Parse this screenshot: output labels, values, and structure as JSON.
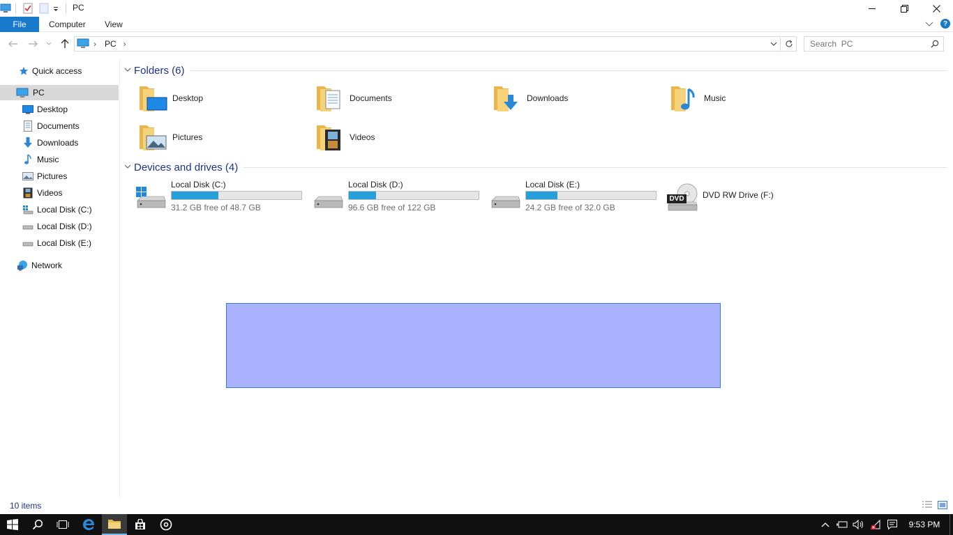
{
  "window": {
    "title": "PC",
    "minimize_glyph": "—",
    "restore_glyph": "❐",
    "close_glyph": "✕"
  },
  "ribbon": {
    "file_label": "File",
    "tabs": [
      "Computer",
      "View"
    ],
    "help_glyph": "?"
  },
  "address": {
    "crumbs": [
      "PC"
    ],
    "separator": "›"
  },
  "search": {
    "placeholder": "Search  PC"
  },
  "nav": {
    "quick_access": "Quick access",
    "pc": "PC",
    "children": [
      "Desktop",
      "Documents",
      "Downloads",
      "Music",
      "Pictures",
      "Videos",
      "Local Disk (C:)",
      "Local Disk (D:)",
      "Local Disk (E:)"
    ],
    "network": "Network"
  },
  "groups": {
    "folders_title": "Folders (6)",
    "devices_title": "Devices and drives (4)"
  },
  "folders": [
    "Desktop",
    "Documents",
    "Downloads",
    "Music",
    "Pictures",
    "Videos"
  ],
  "drives": [
    {
      "label": "Local Disk (C:)",
      "free": "31.2 GB free of 48.7 GB",
      "used_fraction": 0.36
    },
    {
      "label": "Local Disk (D:)",
      "free": "96.6 GB free of 122 GB",
      "used_fraction": 0.21
    },
    {
      "label": "Local Disk (E:)",
      "free": "24.2 GB free of 32.0 GB",
      "used_fraction": 0.24
    },
    {
      "label": "DVD RW Drive (F:)",
      "dvd_text": "DVD"
    }
  ],
  "status": {
    "items": "10 items"
  },
  "taskbar": {
    "time": "9:53 PM"
  },
  "colors": {
    "accent": "#1979ca",
    "bar_fill": "#26a0da",
    "selection": "#a9acff",
    "group_title": "#1e3287"
  }
}
